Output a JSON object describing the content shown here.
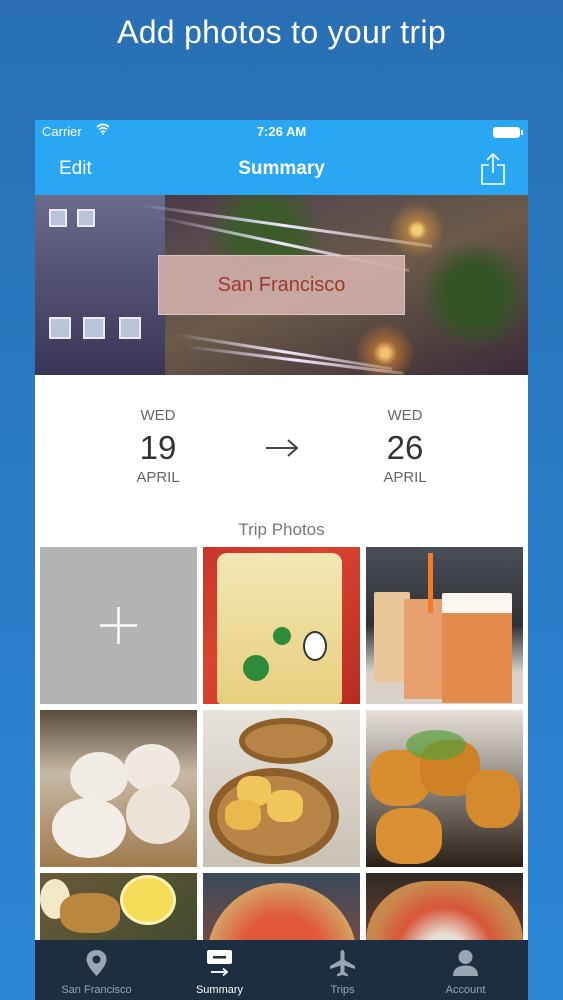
{
  "headline": "Add photos to your trip",
  "status_bar": {
    "carrier": "Carrier",
    "time": "7:26 AM"
  },
  "nav": {
    "edit_label": "Edit",
    "title": "Summary",
    "share_icon": "share-icon"
  },
  "hero": {
    "city": "San Francisco"
  },
  "dates": {
    "start": {
      "weekday": "WED",
      "day": "19",
      "month": "APRIL"
    },
    "end": {
      "weekday": "WED",
      "day": "26",
      "month": "APRIL"
    }
  },
  "photos": {
    "heading": "Trip Photos",
    "add_icon": "plus-icon",
    "tiles": [
      "add-photo",
      "bubble-tea-cup",
      "bubble-tea-drinks",
      "dumplings",
      "dim-sum-baskets",
      "fried-tofu",
      "crab-lemon",
      "pizza",
      "pizza-2"
    ]
  },
  "tabs": [
    {
      "label": "San Francisco",
      "icon": "map-pin-icon",
      "active": false
    },
    {
      "label": "Summary",
      "icon": "summary-icon",
      "active": true
    },
    {
      "label": "Trips",
      "icon": "airplane-icon",
      "active": false
    },
    {
      "label": "Account",
      "icon": "person-icon",
      "active": false
    }
  ],
  "colors": {
    "nav_blue": "#2aa7f2",
    "tabbar": "#1d2e40",
    "background": "#2b7cc4"
  }
}
